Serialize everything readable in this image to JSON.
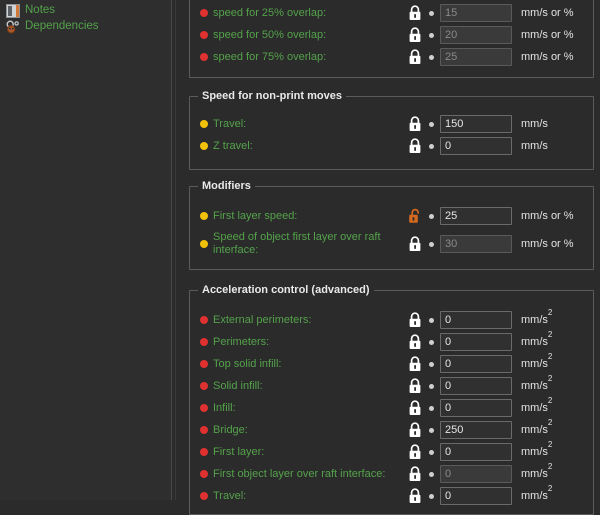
{
  "sidebar": {
    "items": [
      {
        "label": "Notes",
        "icon": "notes-icon"
      },
      {
        "label": "Dependencies",
        "icon": "dependencies-icon"
      }
    ]
  },
  "colors": {
    "background": "#2b2b2b",
    "sidebar_background": "#2e2e2e",
    "label_green": "#54a24b",
    "bullet_red": "#e03131",
    "bullet_yellow": "#f2c20a",
    "lock_white": "#ffffff",
    "lock_orange": "#d2691e",
    "group_border": "#5b5b5b"
  },
  "panel": {
    "groups": [
      {
        "title": "",
        "title_visible": false,
        "rows": [
          {
            "label": "speed for 25% overlap:",
            "bullet": "red",
            "lock": "locked",
            "lock_color": "white",
            "value": "15",
            "unit": "mm/s or %",
            "disabled": true
          },
          {
            "label": "speed for 50% overlap:",
            "bullet": "red",
            "lock": "locked",
            "lock_color": "white",
            "value": "20",
            "unit": "mm/s or %",
            "disabled": true
          },
          {
            "label": "speed for 75% overlap:",
            "bullet": "red",
            "lock": "locked",
            "lock_color": "white",
            "value": "25",
            "unit": "mm/s or %",
            "disabled": true
          }
        ]
      },
      {
        "title": "Speed for non-print moves",
        "title_visible": true,
        "rows": [
          {
            "label": "Travel:",
            "bullet": "yellow",
            "lock": "locked",
            "lock_color": "white",
            "value": "150",
            "unit": "mm/s",
            "disabled": false
          },
          {
            "label": "Z travel:",
            "bullet": "yellow",
            "lock": "locked",
            "lock_color": "white",
            "value": "0",
            "unit": "mm/s",
            "disabled": false
          }
        ]
      },
      {
        "title": "Modifiers",
        "title_visible": true,
        "rows": [
          {
            "label": "First layer speed:",
            "bullet": "yellow",
            "lock": "unlocked",
            "lock_color": "orange",
            "value": "25",
            "unit": "mm/s or %",
            "disabled": false
          },
          {
            "label": "Speed of object first layer over raft interface:",
            "bullet": "yellow",
            "lock": "locked",
            "lock_color": "white",
            "value": "30",
            "unit": "mm/s or %",
            "disabled": true,
            "two_line": true
          }
        ]
      },
      {
        "title": "Acceleration control (advanced)",
        "title_visible": true,
        "rows": [
          {
            "label": "External perimeters:",
            "bullet": "red",
            "lock": "locked",
            "lock_color": "white",
            "value": "0",
            "unit": "mm/s2",
            "disabled": false
          },
          {
            "label": "Perimeters:",
            "bullet": "red",
            "lock": "locked",
            "lock_color": "white",
            "value": "0",
            "unit": "mm/s2",
            "disabled": false
          },
          {
            "label": "Top solid infill:",
            "bullet": "red",
            "lock": "locked",
            "lock_color": "white",
            "value": "0",
            "unit": "mm/s2",
            "disabled": false
          },
          {
            "label": "Solid infill:",
            "bullet": "red",
            "lock": "locked",
            "lock_color": "white",
            "value": "0",
            "unit": "mm/s2",
            "disabled": false
          },
          {
            "label": "Infill:",
            "bullet": "red",
            "lock": "locked",
            "lock_color": "white",
            "value": "0",
            "unit": "mm/s2",
            "disabled": false
          },
          {
            "label": "Bridge:",
            "bullet": "red",
            "lock": "locked",
            "lock_color": "white",
            "value": "250",
            "unit": "mm/s2",
            "disabled": false
          },
          {
            "label": "First layer:",
            "bullet": "red",
            "lock": "locked",
            "lock_color": "white",
            "value": "0",
            "unit": "mm/s2",
            "disabled": false
          },
          {
            "label": "First object layer over raft interface:",
            "bullet": "red",
            "lock": "locked",
            "lock_color": "white",
            "value": "0",
            "unit": "mm/s2",
            "disabled": true
          },
          {
            "label": "Travel:",
            "bullet": "red",
            "lock": "locked",
            "lock_color": "white",
            "value": "0",
            "unit": "mm/s2",
            "disabled": false
          }
        ]
      }
    ]
  }
}
